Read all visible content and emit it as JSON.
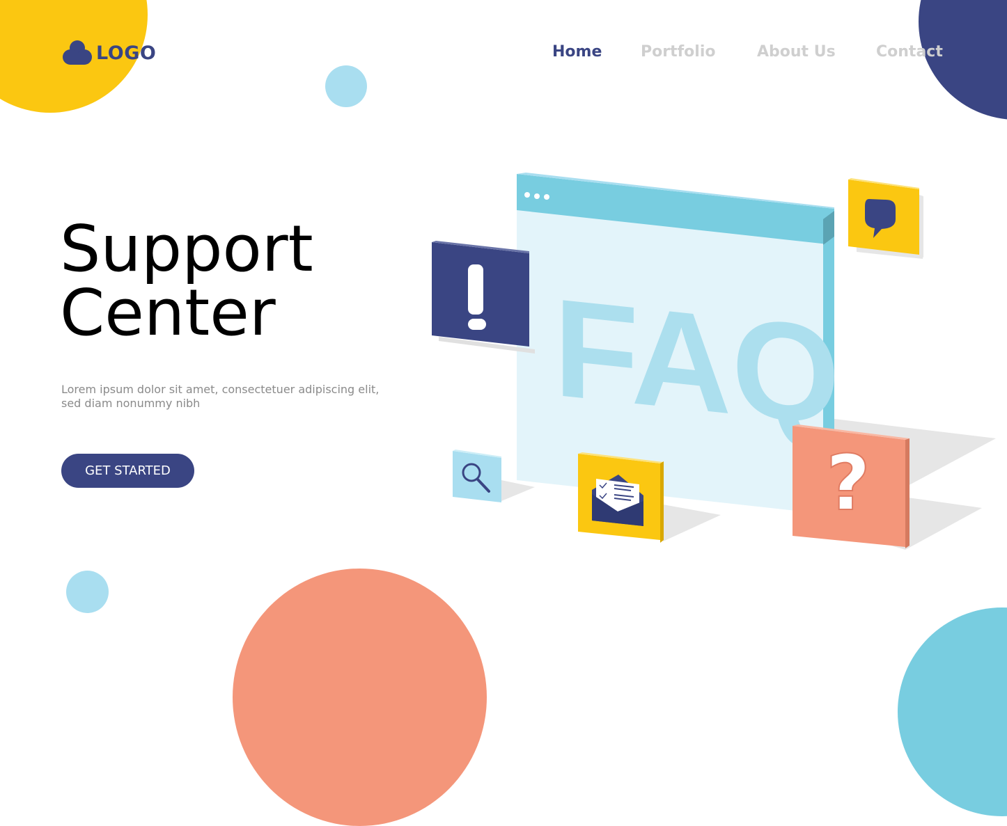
{
  "brand": {
    "logo_text": "LOGO",
    "logo_icon": "cloud-icon"
  },
  "nav": {
    "items": [
      {
        "label": "Home",
        "active": true
      },
      {
        "label": "Portfolio",
        "active": false
      },
      {
        "label": "About Us",
        "active": false
      },
      {
        "label": "Contact",
        "active": false
      }
    ]
  },
  "hero": {
    "title_line1": "Support",
    "title_line2": "Center",
    "description": "Lorem ipsum dolor sit amet, consectetuer adipiscing elit, sed diam nonummy nibh",
    "cta_label": "GET STARTED"
  },
  "illustration": {
    "window_text": "FAQ",
    "tiles": [
      {
        "icon": "exclamation-icon",
        "color": "#3a4583"
      },
      {
        "icon": "speech-bubble-icon",
        "color": "#fbc711"
      },
      {
        "icon": "magnifier-icon",
        "color": "#a9def0"
      },
      {
        "icon": "envelope-letter-icon",
        "color": "#fbc711"
      },
      {
        "icon": "question-mark-icon",
        "color": "#f4967a"
      }
    ]
  },
  "colors": {
    "navy": "#3a4583",
    "yellow": "#fbc711",
    "salmon": "#f4967a",
    "teal": "#78cde0",
    "light_blue": "#a9def0",
    "nav_inactive": "#cfcfcf"
  }
}
